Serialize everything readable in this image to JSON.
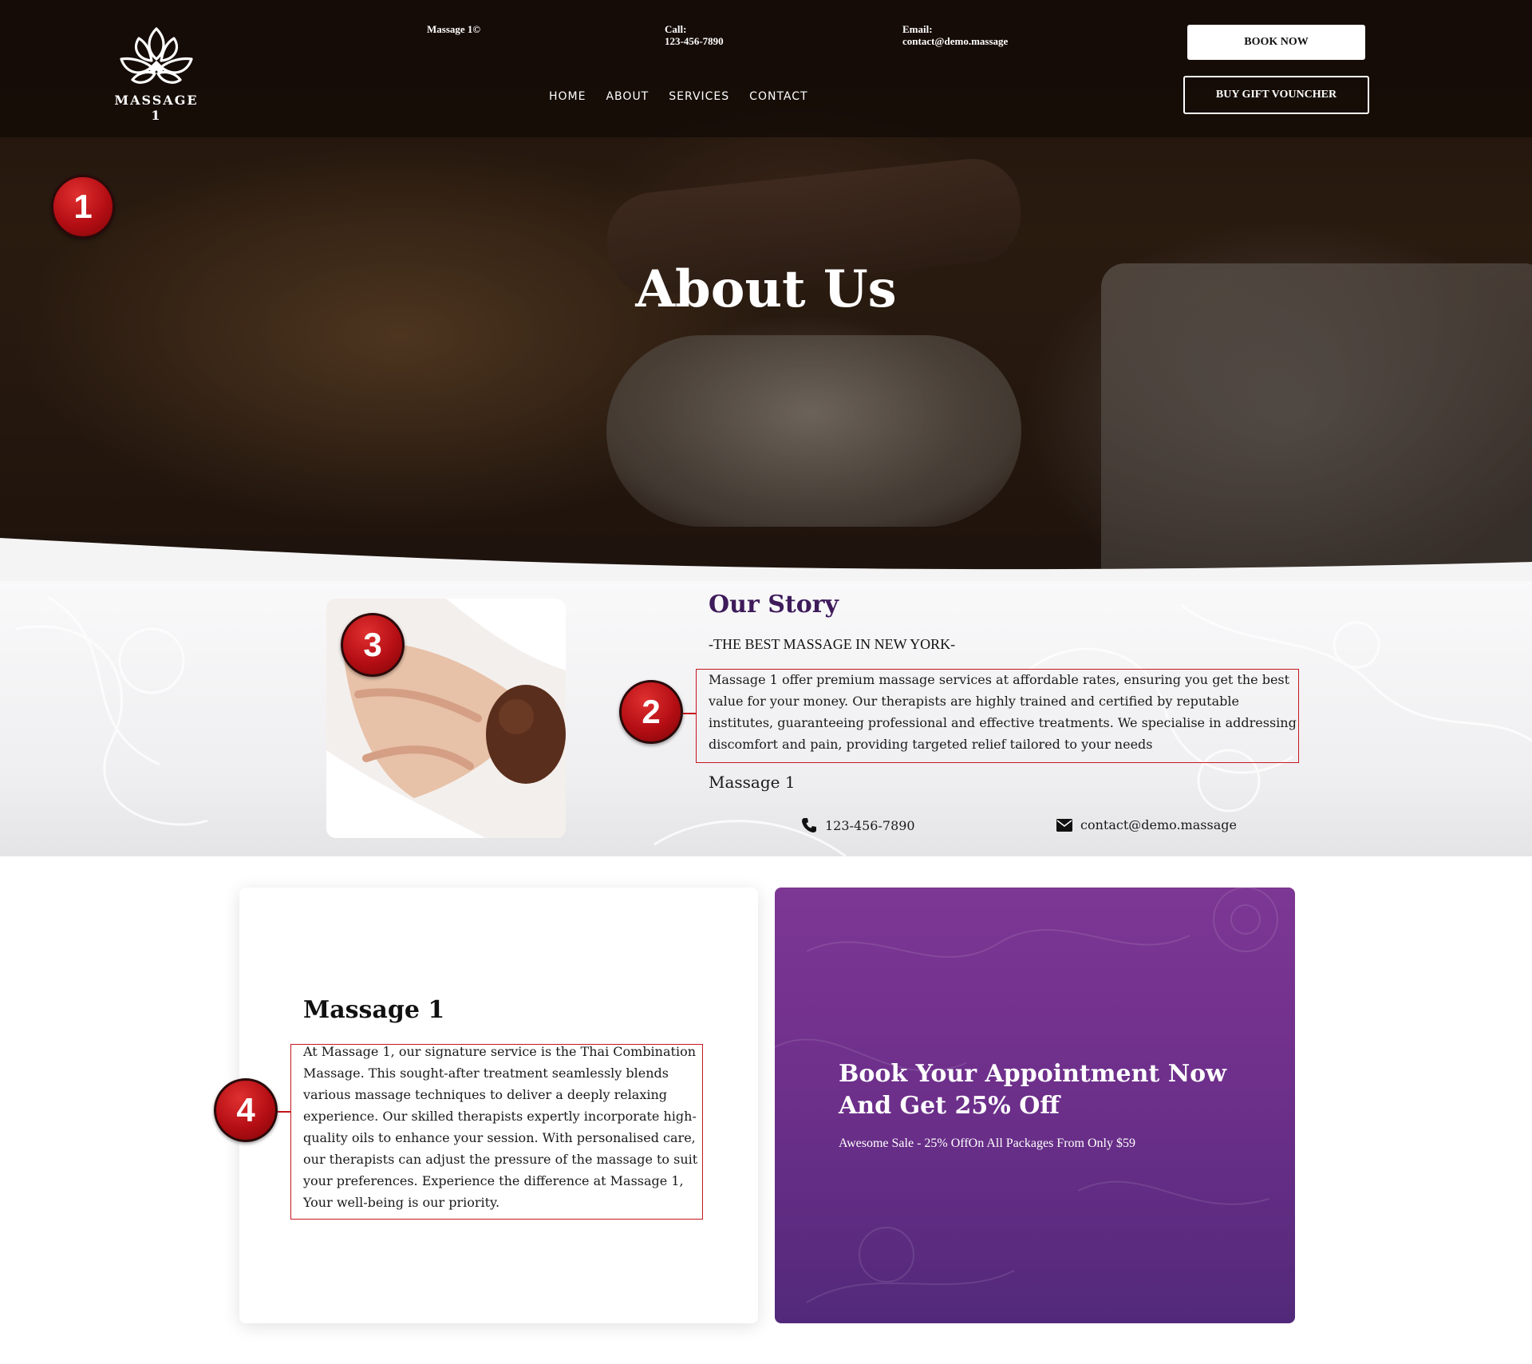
{
  "header": {
    "logo_text": "MASSAGE 1",
    "brand_info": "Massage 1©",
    "call_label": "Call:",
    "call_value": "123-456-7890",
    "email_label": "Email:",
    "email_value": "contact@demo.massage",
    "nav": [
      "HOME",
      "ABOUT",
      "SERVICES",
      "CONTACT"
    ],
    "book_button": "BOOK NOW",
    "gift_button": "BUY GIFT VOUNCHER"
  },
  "hero": {
    "title": "About Us"
  },
  "story": {
    "title": "Our Story",
    "subtitle": "-THE BEST MASSAGE IN NEW YORK-",
    "text": "Massage 1 offer premium massage services at affordable rates, ensuring you get the best value for your money. Our therapists are highly trained and certified by reputable institutes, guaranteeing professional and effective treatments. We specialise in addressing discomfort and pain, providing targeted relief tailored to your needs",
    "brand": "Massage 1",
    "phone": "123-456-7890",
    "email": "contact@demo.massage"
  },
  "card_left": {
    "title": "Massage 1",
    "text": "At Massage 1, our signature service is the Thai Combination Massage. This sought-after treatment seamlessly blends various massage techniques to deliver a deeply relaxing experience. Our skilled therapists expertly incorporate high-quality oils to enhance your session. With personalised care, our therapists can adjust the pressure of the massage to suit your preferences. Experience the difference at Massage 1, Your well-being is our priority."
  },
  "card_right": {
    "title": "Book Your Appointment Now And Get 25% Off",
    "subtitle": "Awesome Sale - 25% OffOn All Packages From Only $59"
  },
  "annotations": {
    "badge_1": "1",
    "badge_2": "2",
    "badge_3": "3",
    "badge_4": "4",
    "color": "#c4161c"
  },
  "icons": {
    "logo": "lotus-flower-icon",
    "phone": "phone-icon",
    "email": "envelope-icon"
  },
  "colors": {
    "accent_purple": "#3e1b5a",
    "card_purple": "#6c2f8a",
    "badge_red": "#b40e14"
  }
}
